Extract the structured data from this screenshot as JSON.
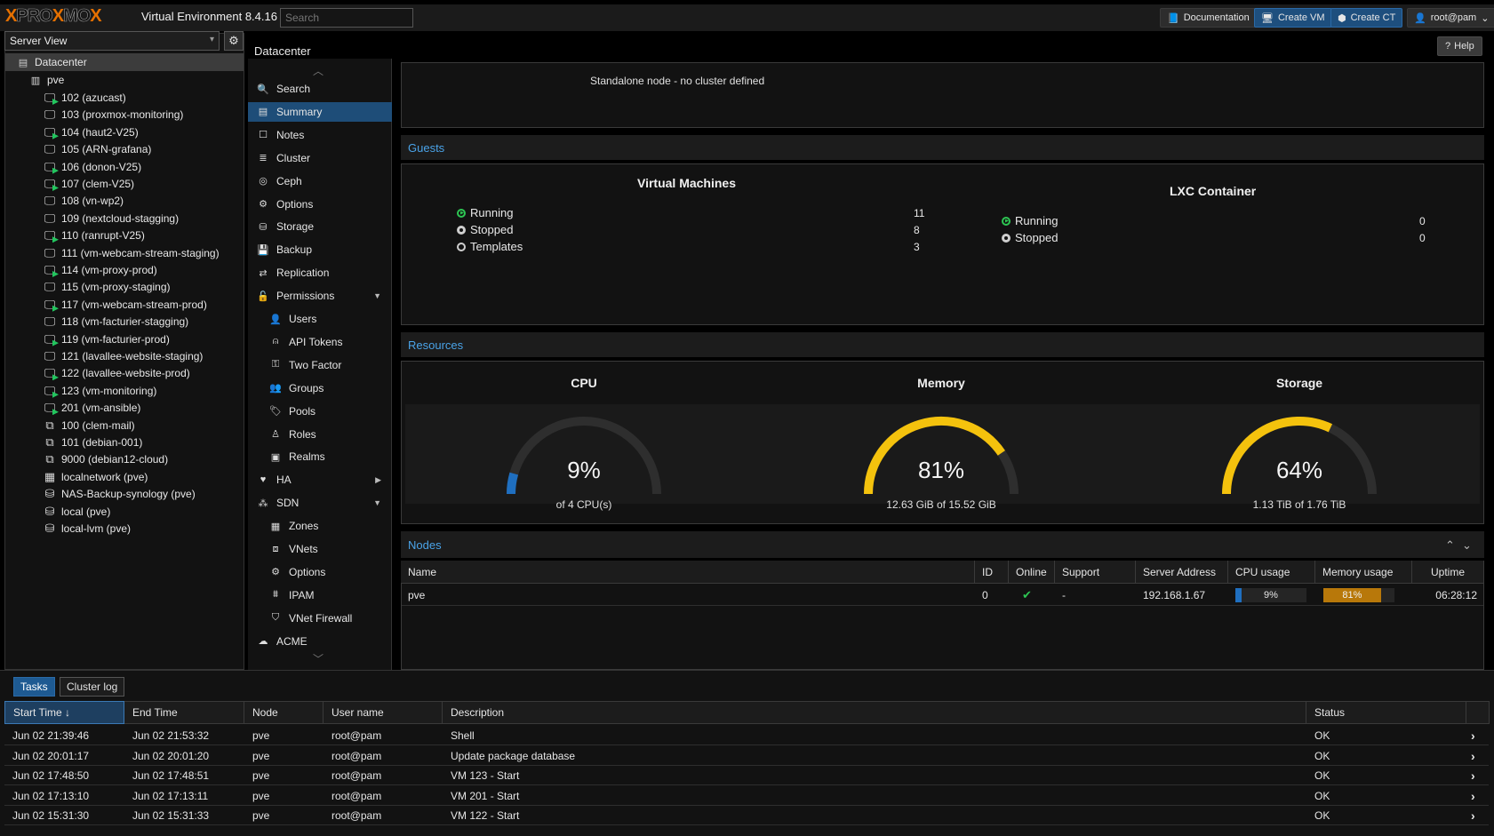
{
  "header": {
    "logo": [
      "X",
      "PRO",
      "X",
      "MO",
      "X"
    ],
    "version": "Virtual Environment 8.4.16",
    "search_placeholder": "Search",
    "documentation": "Documentation",
    "create_vm": "Create VM",
    "create_ct": "Create CT",
    "user": "root@pam"
  },
  "tree": {
    "view": "Server View",
    "datacenter": "Datacenter",
    "node": "pve",
    "items": [
      {
        "label": "102 (azucast)",
        "type": "vm-run"
      },
      {
        "label": "103 (proxmox-monitoring)",
        "type": "vm"
      },
      {
        "label": "104 (haut2-V25)",
        "type": "vm-run"
      },
      {
        "label": "105 (ARN-grafana)",
        "type": "vm"
      },
      {
        "label": "106 (donon-V25)",
        "type": "vm-run"
      },
      {
        "label": "107 (clem-V25)",
        "type": "vm-run"
      },
      {
        "label": "108 (vn-wp2)",
        "type": "vm"
      },
      {
        "label": "109 (nextcloud-stagging)",
        "type": "vm"
      },
      {
        "label": "110 (ranrupt-V25)",
        "type": "vm-run"
      },
      {
        "label": "111 (vm-webcam-stream-staging)",
        "type": "vm"
      },
      {
        "label": "114 (vm-proxy-prod)",
        "type": "vm-run"
      },
      {
        "label": "115 (vm-proxy-staging)",
        "type": "vm"
      },
      {
        "label": "117 (vm-webcam-stream-prod)",
        "type": "vm-run"
      },
      {
        "label": "118 (vm-facturier-stagging)",
        "type": "vm"
      },
      {
        "label": "119 (vm-facturier-prod)",
        "type": "vm-run"
      },
      {
        "label": "121 (lavallee-website-staging)",
        "type": "vm"
      },
      {
        "label": "122 (lavallee-website-prod)",
        "type": "vm-run"
      },
      {
        "label": "123 (vm-monitoring)",
        "type": "vm-run"
      },
      {
        "label": "201 (vm-ansible)",
        "type": "vm-run"
      },
      {
        "label": "100 (clem-mail)",
        "type": "ct"
      },
      {
        "label": "101 (debian-001)",
        "type": "ct"
      },
      {
        "label": "9000 (debian12-cloud)",
        "type": "ct"
      },
      {
        "label": "localnetwork (pve)",
        "type": "net"
      },
      {
        "label": "NAS-Backup-synology (pve)",
        "type": "storage"
      },
      {
        "label": "local (pve)",
        "type": "storage"
      },
      {
        "label": "local-lvm (pve)",
        "type": "storage"
      }
    ]
  },
  "content": {
    "title": "Datacenter",
    "help": "Help",
    "cluster_status": "Standalone node - no cluster defined"
  },
  "menu": [
    {
      "label": "Search",
      "icon": "search-icon"
    },
    {
      "label": "Summary",
      "icon": "book-icon",
      "selected": true
    },
    {
      "label": "Notes",
      "icon": "notes-icon"
    },
    {
      "label": "Cluster",
      "icon": "server-icon"
    },
    {
      "label": "Ceph",
      "icon": "ceph-icon"
    },
    {
      "label": "Options",
      "icon": "gear-icon"
    },
    {
      "label": "Storage",
      "icon": "database-icon"
    },
    {
      "label": "Backup",
      "icon": "floppy-icon"
    },
    {
      "label": "Replication",
      "icon": "retweet-icon"
    },
    {
      "label": "Permissions",
      "icon": "unlock-icon",
      "caret": "down"
    },
    {
      "label": "Users",
      "icon": "user-icon",
      "sub": true
    },
    {
      "label": "API Tokens",
      "icon": "user-outline-icon",
      "sub": true
    },
    {
      "label": "Two Factor",
      "icon": "key-icon",
      "sub": true
    },
    {
      "label": "Groups",
      "icon": "users-icon",
      "sub": true
    },
    {
      "label": "Pools",
      "icon": "tags-icon",
      "sub": true
    },
    {
      "label": "Roles",
      "icon": "male-icon",
      "sub": true
    },
    {
      "label": "Realms",
      "icon": "address-book-icon",
      "sub": true
    },
    {
      "label": "HA",
      "icon": "heartbeat-icon",
      "caret": "right"
    },
    {
      "label": "SDN",
      "icon": "sdn-icon",
      "caret": "down"
    },
    {
      "label": "Zones",
      "icon": "grid-icon",
      "sub": true
    },
    {
      "label": "VNets",
      "icon": "sitemap-icon",
      "sub": true
    },
    {
      "label": "Options",
      "icon": "gear-icon",
      "sub": true
    },
    {
      "label": "IPAM",
      "icon": "ipam-icon",
      "sub": true
    },
    {
      "label": "VNet Firewall",
      "icon": "shield-icon",
      "sub": true
    },
    {
      "label": "ACME",
      "icon": "cloud-icon"
    }
  ],
  "guests": {
    "title": "Guests",
    "vm": {
      "title": "Virtual Machines",
      "rows": [
        {
          "label": "Running",
          "value": "11",
          "state": "run"
        },
        {
          "label": "Stopped",
          "value": "8",
          "state": "stop"
        },
        {
          "label": "Templates",
          "value": "3",
          "state": "tmpl"
        }
      ]
    },
    "lxc": {
      "title": "LXC Container",
      "rows": [
        {
          "label": "Running",
          "value": "0",
          "state": "run"
        },
        {
          "label": "Stopped",
          "value": "0",
          "state": "stop"
        }
      ]
    }
  },
  "resources": {
    "title": "Resources",
    "cpu": {
      "title": "CPU",
      "percent": 9,
      "value": "9%",
      "sub": "of 4 CPU(s)",
      "color": "#1f6fc0"
    },
    "memory": {
      "title": "Memory",
      "percent": 81,
      "value": "81%",
      "sub": "12.63 GiB of 15.52 GiB",
      "color": "#f4c20d"
    },
    "storage": {
      "title": "Storage",
      "percent": 64,
      "value": "64%",
      "sub": "1.13 TiB of 1.76 TiB",
      "color": "#f4c20d"
    }
  },
  "nodes": {
    "title": "Nodes",
    "columns": [
      "Name",
      "ID",
      "Online",
      "Support",
      "Server Address",
      "CPU usage",
      "Memory usage",
      "Uptime"
    ],
    "rows": [
      {
        "name": "pve",
        "id": "0",
        "online": "✔",
        "support": "-",
        "address": "192.168.1.67",
        "cpu": "9%",
        "cpu_pct": 9,
        "memory": "81%",
        "mem_pct": 81,
        "uptime": "06:28:12"
      }
    ]
  },
  "tasks": {
    "tab_tasks": "Tasks",
    "tab_log": "Cluster log",
    "columns": [
      "Start Time ↓",
      "End Time",
      "Node",
      "User name",
      "Description",
      "Status"
    ],
    "rows": [
      {
        "start": "Jun 02 21:39:46",
        "end": "Jun 02 21:53:32",
        "node": "pve",
        "user": "root@pam",
        "desc": "Shell",
        "status": "OK"
      },
      {
        "start": "Jun 02 20:01:17",
        "end": "Jun 02 20:01:20",
        "node": "pve",
        "user": "root@pam",
        "desc": "Update package database",
        "status": "OK"
      },
      {
        "start": "Jun 02 17:48:50",
        "end": "Jun 02 17:48:51",
        "node": "pve",
        "user": "root@pam",
        "desc": "VM 123 - Start",
        "status": "OK"
      },
      {
        "start": "Jun 02 17:13:10",
        "end": "Jun 02 17:13:11",
        "node": "pve",
        "user": "root@pam",
        "desc": "VM 201 - Start",
        "status": "OK"
      },
      {
        "start": "Jun 02 15:31:30",
        "end": "Jun 02 15:31:33",
        "node": "pve",
        "user": "root@pam",
        "desc": "VM 122 - Start",
        "status": "OK"
      }
    ]
  }
}
